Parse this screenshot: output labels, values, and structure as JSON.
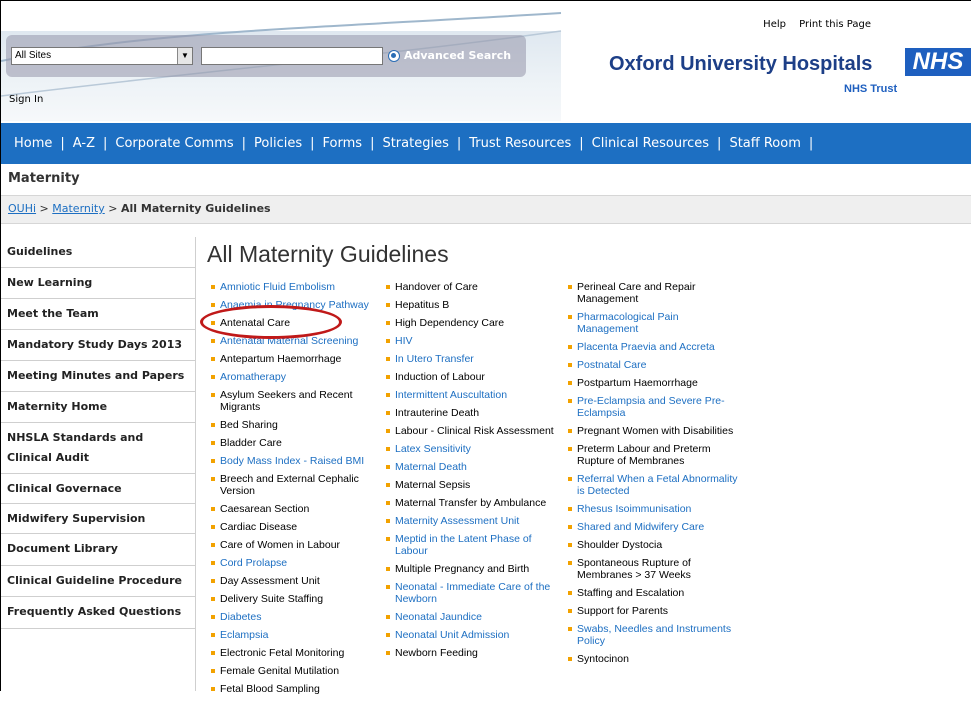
{
  "header": {
    "utility_links": [
      "Help",
      "Print this Page"
    ],
    "site_selector": "All Sites",
    "search_placeholder": "",
    "advanced_search": "Advanced Search",
    "sign_in": "Sign In",
    "org_name": "Oxford University Hospitals",
    "nhs_badge": "NHS",
    "org_sub": "NHS Trust"
  },
  "nav": [
    "Home",
    "A-Z",
    "Corporate Comms",
    "Policies",
    "Forms",
    "Strategies",
    "Trust Resources",
    "Clinical Resources",
    "Staff Room"
  ],
  "site_title": "Maternity",
  "breadcrumb": {
    "home": "OUHi",
    "section": "Maternity",
    "sep": ">",
    "current": "All Maternity Guidelines"
  },
  "sidenav": [
    "Guidelines",
    "New Learning",
    "Meet the Team",
    "Mandatory Study Days 2013",
    "Meeting Minutes and Papers",
    "Maternity Home",
    "NHSLA Standards and Clinical Audit",
    "Clinical Governace",
    "Midwifery Supervision",
    "Document Library",
    "Clinical Guideline Procedure",
    "Frequently Asked Questions"
  ],
  "page_title": "All Maternity Guidelines",
  "columns": [
    [
      "Amniotic Fluid Embolism",
      "Anaemia in Pregnancy Pathway",
      "Antenatal Care",
      "Antenatal Maternal Screening",
      "Antepartum Haemorrhage",
      "Aromatherapy",
      "Asylum Seekers and Recent Migrants",
      "Bed Sharing",
      "Bladder Care",
      "Body Mass Index - Raised BMI",
      "Breech and External Cephalic Version",
      "Caesarean Section",
      "Cardiac Disease",
      "Care of Women in Labour",
      "Cord Prolapse",
      "Day Assessment Unit",
      "Delivery Suite Staffing",
      "Diabetes",
      "Eclampsia",
      "Electronic Fetal Monitoring",
      "Female Genital Mutilation",
      "Fetal Blood Sampling"
    ],
    [
      "Handover of Care",
      "Hepatitus B",
      "High Dependency Care",
      "HIV",
      "In Utero Transfer",
      "Induction of Labour",
      "Intermittent Auscultation",
      "Intrauterine Death",
      "Labour - Clinical Risk Assessment",
      "Latex Sensitivity",
      "Maternal Death",
      "Maternal Sepsis",
      "Maternal Transfer by Ambulance",
      "Maternity Assessment Unit",
      "Meptid in the Latent Phase of Labour",
      "Multiple Pregnancy and Birth",
      "Neonatal - Immediate Care of the Newborn",
      "Neonatal Jaundice",
      "Neonatal Unit Admission",
      "Newborn Feeding"
    ],
    [
      "Perineal Care and Repair Management",
      "Pharmacological Pain Management",
      "Placenta Praevia and Accreta",
      "Postnatal Care",
      "Postpartum Haemorrhage",
      "Pre-Eclampsia and Severe Pre-Eclampsia",
      "Pregnant Women with Disabilities",
      "Preterm Labour and Preterm Rupture of Membranes",
      "Referral When a Fetal Abnormality is Detected",
      "Rhesus Isoimmunisation",
      "Shared and Midwifery Care",
      "Shoulder Dystocia",
      "Spontaneous Rupture of Membranes > 37 Weeks",
      "Staffing and Escalation",
      "Support for Parents",
      "Swabs, Needles and Instruments Policy",
      "Syntocinon"
    ]
  ],
  "colors": {
    "nav_bg": "#1d6fc2",
    "link": "#1d6fc2",
    "bullet": "#f2a200",
    "highlight": "#c01919",
    "brand": "#1d3f87"
  }
}
